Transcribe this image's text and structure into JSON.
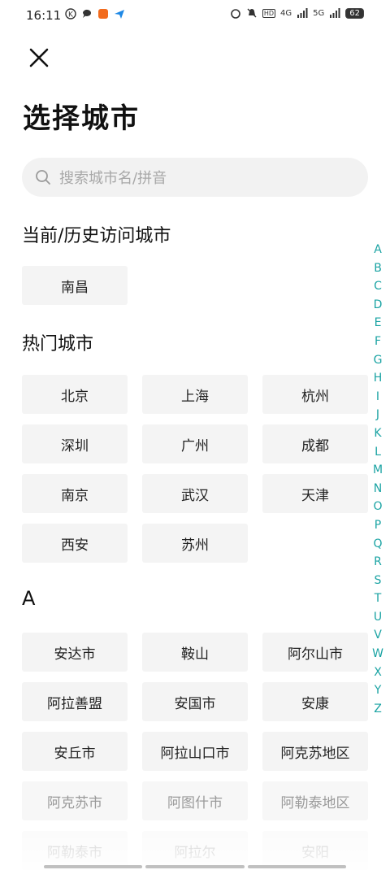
{
  "status": {
    "time": "16:11",
    "battery": "62",
    "net1": "4G",
    "net2": "5G",
    "hd": "HD"
  },
  "header": {
    "title": "选择城市"
  },
  "search": {
    "placeholder": "搜索城市名/拼音"
  },
  "current": {
    "title": "当前/历史访问城市",
    "cities": [
      "南昌"
    ]
  },
  "hot": {
    "title": "热门城市",
    "cities": [
      "北京",
      "上海",
      "杭州",
      "深圳",
      "广州",
      "成都",
      "南京",
      "武汉",
      "天津",
      "西安",
      "苏州"
    ]
  },
  "sectionA": {
    "title": "A",
    "cities": [
      "安达市",
      "鞍山",
      "阿尔山市",
      "阿拉善盟",
      "安国市",
      "安康",
      "安丘市",
      "阿拉山口市",
      "阿克苏地区",
      "阿克苏市",
      "阿图什市",
      "阿勒泰地区",
      "阿勒泰市",
      "阿拉尔",
      "安阳"
    ]
  },
  "index": [
    "A",
    "B",
    "C",
    "D",
    "E",
    "F",
    "G",
    "H",
    "I",
    "J",
    "K",
    "L",
    "M",
    "N",
    "O",
    "P",
    "Q",
    "R",
    "S",
    "T",
    "U",
    "V",
    "W",
    "X",
    "Y",
    "Z"
  ],
  "colors": {
    "accent": "#1aa3a3",
    "chip": "#f4f4f4",
    "search": "#f2f2f2"
  }
}
